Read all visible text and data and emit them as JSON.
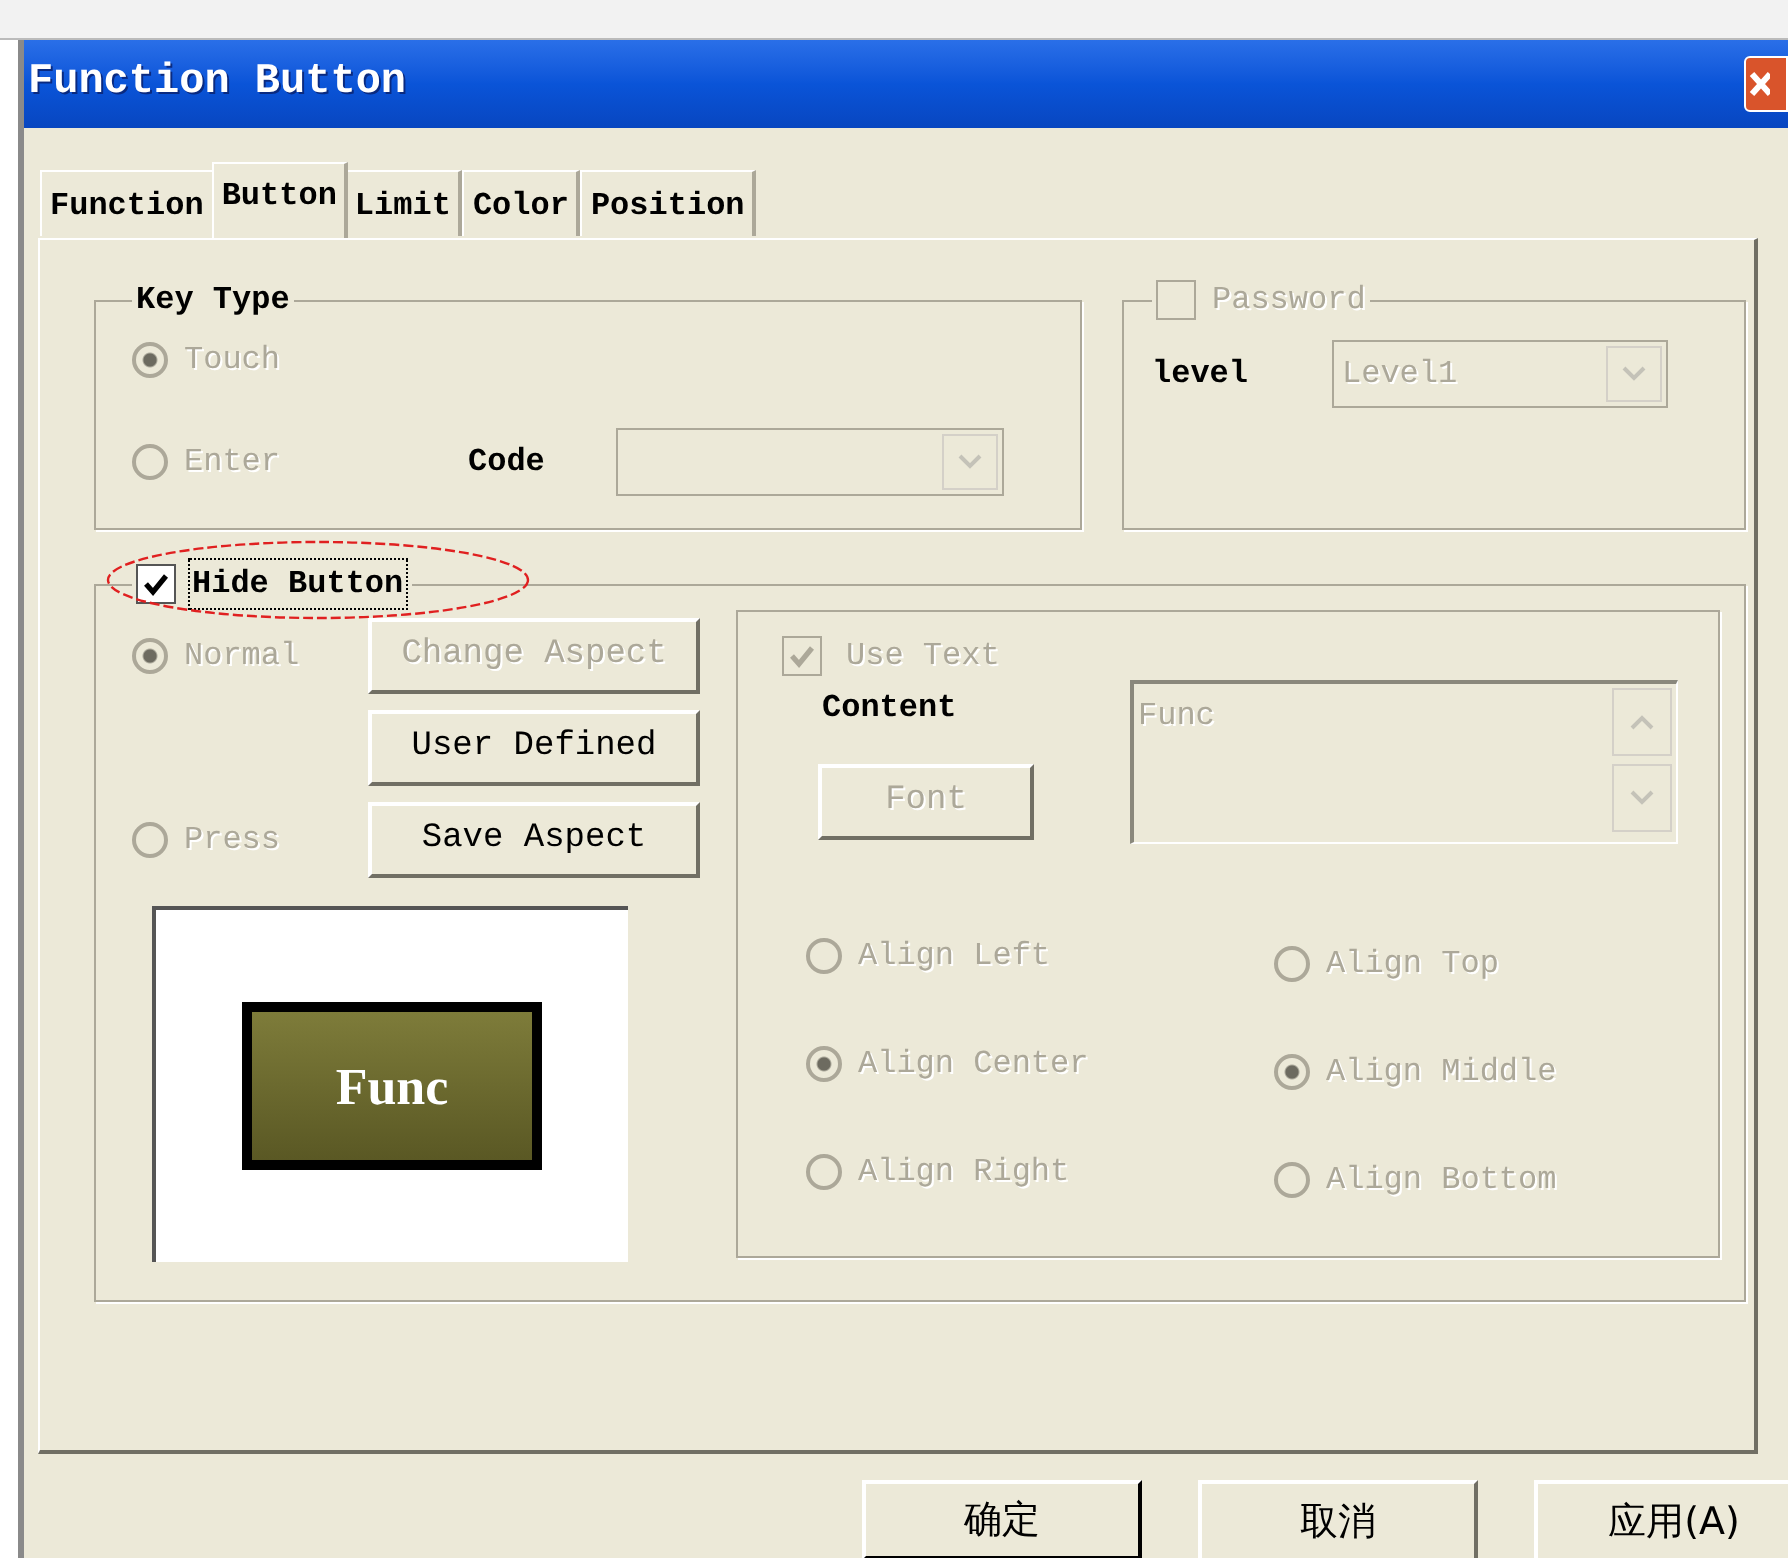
{
  "window": {
    "title": "Function Button"
  },
  "tabs": [
    {
      "label": "Function",
      "selected": false
    },
    {
      "label": "Button",
      "selected": true
    },
    {
      "label": "Limit",
      "selected": false
    },
    {
      "label": "Color",
      "selected": false
    },
    {
      "label": "Position",
      "selected": false
    }
  ],
  "key_type": {
    "title": "Key Type",
    "disabled": true,
    "options": [
      {
        "label": "Touch",
        "selected": true
      },
      {
        "label": "Enter",
        "selected": false
      }
    ],
    "code_label": "Code"
  },
  "password": {
    "label": "Password",
    "checked": false,
    "disabled": true,
    "level_label": "level",
    "level_value": "Level1"
  },
  "hide_button": {
    "label": "Hide Button",
    "checked": true,
    "highlighted": true
  },
  "aspect": {
    "disabled": true,
    "options": [
      {
        "label": "Normal",
        "selected": true
      },
      {
        "label": "Press",
        "selected": false
      }
    ],
    "buttons": [
      {
        "label": "Change Aspect",
        "disabled": true
      },
      {
        "label": "User Defined",
        "disabled": false
      },
      {
        "label": "Save Aspect",
        "disabled": false
      }
    ],
    "preview_label": "Func"
  },
  "text": {
    "disabled": true,
    "use_text": {
      "label": "Use Text",
      "checked": true
    },
    "content_label": "Content",
    "font_button": "Font",
    "content_value": "Func",
    "align_h": [
      {
        "label": "Align Left",
        "selected": false
      },
      {
        "label": "Align Center",
        "selected": true
      },
      {
        "label": "Align Right",
        "selected": false
      }
    ],
    "align_v": [
      {
        "label": "Align Top",
        "selected": false
      },
      {
        "label": "Align Middle",
        "selected": true
      },
      {
        "label": "Align Bottom",
        "selected": false
      }
    ]
  },
  "buttons": [
    {
      "label": "确定",
      "default": true
    },
    {
      "label": "取消",
      "default": false
    },
    {
      "label": "应用(A)",
      "default": false
    }
  ]
}
